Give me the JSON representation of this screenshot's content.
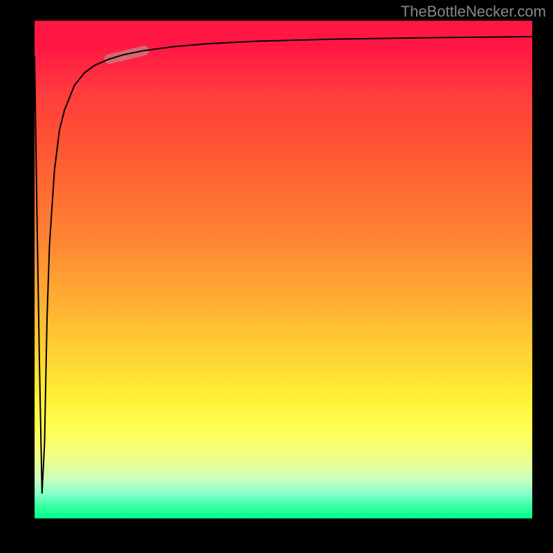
{
  "watermark": "TheBottleNecker.com",
  "chart_data": {
    "type": "line",
    "title": "",
    "xlabel": "",
    "ylabel": "",
    "xlim": [
      0,
      100
    ],
    "ylim": [
      0,
      100
    ],
    "series": [
      {
        "name": "curve",
        "x": [
          0,
          0.5,
          1,
          1.5,
          2,
          2.5,
          3,
          4,
          5,
          6,
          8,
          10,
          12,
          15,
          18,
          22,
          28,
          35,
          45,
          60,
          80,
          100
        ],
        "values": [
          93,
          60,
          30,
          5,
          15,
          40,
          55,
          70,
          78,
          82,
          87,
          89.5,
          91,
          92.3,
          93.2,
          94,
          94.8,
          95.4,
          95.9,
          96.3,
          96.6,
          96.8
        ]
      }
    ],
    "highlight_segment": {
      "x_start": 15,
      "x_end": 22,
      "y_start": 92.3,
      "y_end": 94
    },
    "background_gradient": {
      "top": "#ff1744",
      "mid_upper": "#ff8833",
      "mid": "#ffee33",
      "bottom": "#00ff88"
    }
  }
}
